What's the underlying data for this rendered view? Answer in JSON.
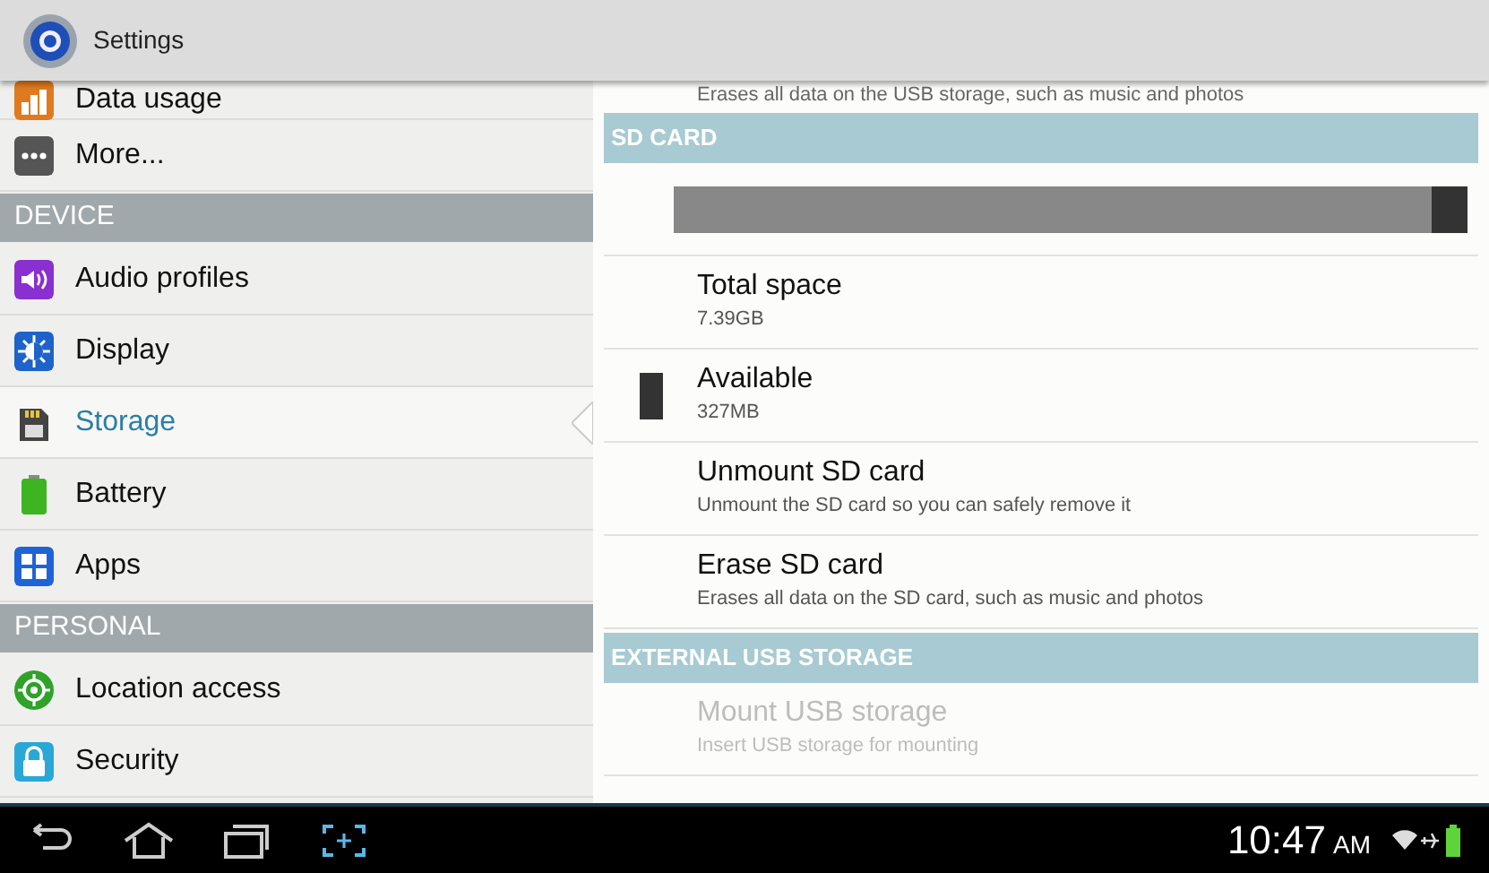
{
  "title_bar": {
    "title": "Settings"
  },
  "sidebar": {
    "items": [
      {
        "kind": "item",
        "label": "Data usage",
        "selected": false
      },
      {
        "kind": "item",
        "label": "More...",
        "selected": false
      },
      {
        "kind": "header",
        "label": "DEVICE"
      },
      {
        "kind": "item",
        "label": "Audio profiles",
        "selected": false
      },
      {
        "kind": "item",
        "label": "Display",
        "selected": false
      },
      {
        "kind": "item",
        "label": "Storage",
        "selected": true
      },
      {
        "kind": "item",
        "label": "Battery",
        "selected": false
      },
      {
        "kind": "item",
        "label": "Apps",
        "selected": false
      },
      {
        "kind": "header",
        "label": "PERSONAL"
      },
      {
        "kind": "item",
        "label": "Location access",
        "selected": false
      },
      {
        "kind": "item",
        "label": "Security",
        "selected": false
      }
    ]
  },
  "content": {
    "items": [
      {
        "kind": "cut",
        "summary": "Erases all data on the USB storage, such as music and photos"
      },
      {
        "kind": "header",
        "label": "SD CARD"
      },
      {
        "kind": "bar",
        "level": 0.955
      },
      {
        "kind": "pref",
        "title": "Total space",
        "summary": "7.39GB",
        "disabled": false
      },
      {
        "kind": "pref",
        "title": "Available",
        "summary": "327MB",
        "disabled": false,
        "color": "#333333"
      },
      {
        "kind": "pref",
        "title": "Unmount SD card",
        "summary": "Unmount the SD card so you can safely remove it",
        "disabled": false
      },
      {
        "kind": "pref",
        "title": "Erase SD card",
        "summary": "Erases all data on the SD card, such as music and photos",
        "disabled": false
      },
      {
        "kind": "header",
        "label": "EXTERNAL USB STORAGE"
      },
      {
        "kind": "pref",
        "title": "Mount USB storage",
        "summary": "Insert USB storage for mounting",
        "disabled": true
      }
    ]
  },
  "status_bar": {
    "time": "10:47",
    "ampm": "AM"
  }
}
